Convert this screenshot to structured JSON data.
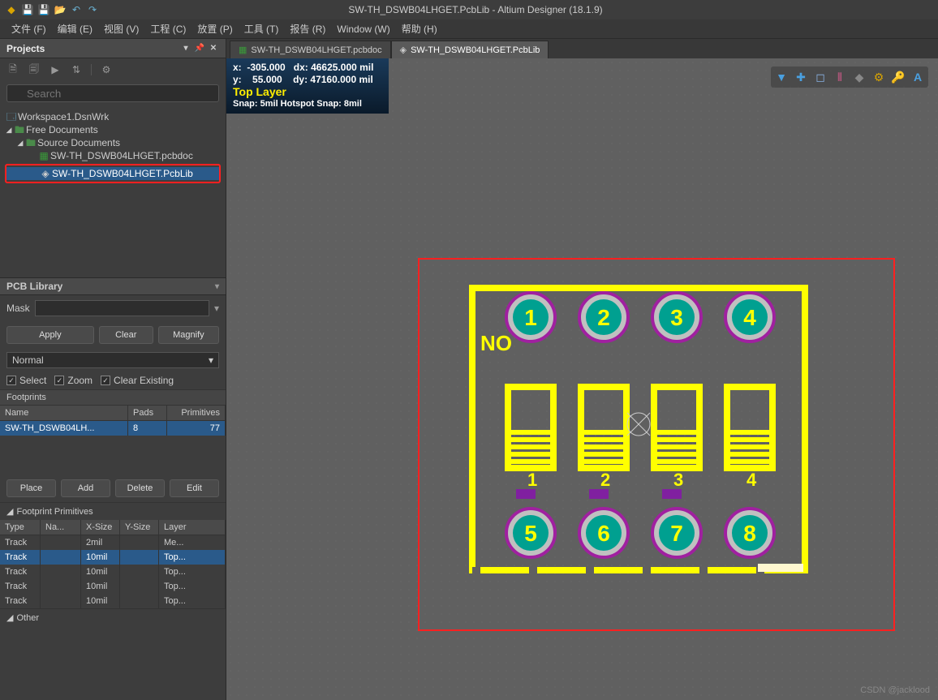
{
  "title": "SW-TH_DSWB04LHGET.PcbLib - Altium Designer (18.1.9)",
  "menu": [
    "文件 (F)",
    "编辑 (E)",
    "视图 (V)",
    "工程 (C)",
    "放置 (P)",
    "工具 (T)",
    "报告 (R)",
    "Window (W)",
    "帮助 (H)"
  ],
  "projects_panel": {
    "title": "Projects",
    "search_placeholder": "Search",
    "tree": {
      "workspace": "Workspace1.DsnWrk",
      "group": "Free Documents",
      "subgroup": "Source Documents",
      "doc1": "SW-TH_DSWB04LHGET.pcbdoc",
      "doc2": "SW-TH_DSWB04LHGET.PcbLib"
    }
  },
  "pcblib_panel": {
    "title": "PCB Library",
    "mask_label": "Mask",
    "buttons": {
      "apply": "Apply",
      "clear": "Clear",
      "magnify": "Magnify"
    },
    "mode": "Normal",
    "checks": {
      "select": "Select",
      "zoom": "Zoom",
      "clear_existing": "Clear Existing"
    },
    "footprints_label": "Footprints",
    "cols": {
      "name": "Name",
      "pads": "Pads",
      "primitives": "Primitives"
    },
    "row": {
      "name": "SW-TH_DSWB04LH...",
      "pads": "8",
      "primitives": "77"
    },
    "actions": {
      "place": "Place",
      "add": "Add",
      "delete": "Delete",
      "edit": "Edit"
    },
    "prim_header": "Footprint Primitives",
    "prim_cols": {
      "type": "Type",
      "name": "Na...",
      "xsize": "X-Size",
      "ysize": "Y-Size",
      "layer": "Layer"
    },
    "prim_rows": [
      {
        "type": "Track",
        "name": "",
        "xsize": "2mil",
        "ysize": "",
        "layer": "Me..."
      },
      {
        "type": "Track",
        "name": "",
        "xsize": "10mil",
        "ysize": "",
        "layer": "Top..."
      },
      {
        "type": "Track",
        "name": "",
        "xsize": "10mil",
        "ysize": "",
        "layer": "Top..."
      },
      {
        "type": "Track",
        "name": "",
        "xsize": "10mil",
        "ysize": "",
        "layer": "Top..."
      },
      {
        "type": "Track",
        "name": "",
        "xsize": "10mil",
        "ysize": "",
        "layer": "Top..."
      }
    ],
    "other_label": "Other"
  },
  "tabs": [
    {
      "label": "SW-TH_DSWB04LHGET.pcbdoc",
      "active": false
    },
    {
      "label": "SW-TH_DSWB04LHGET.PcbLib",
      "active": true
    }
  ],
  "hud": {
    "x_label": "x:",
    "x": "-305.000",
    "dx_label": "dx:",
    "dx": "46625.000 mil",
    "y_label": "y:",
    "y": "55.000",
    "dy_label": "dy:",
    "dy": "47160.000 mil",
    "layer": "Top Layer",
    "snap": "Snap: 5mil Hotspot Snap: 8mil"
  },
  "pcb": {
    "silk_text": "NO",
    "pads": [
      "1",
      "2",
      "3",
      "4",
      "5",
      "6",
      "7",
      "8"
    ],
    "switch_labels": [
      "1",
      "2",
      "3",
      "4"
    ]
  },
  "watermark": "CSDN @jacklood"
}
